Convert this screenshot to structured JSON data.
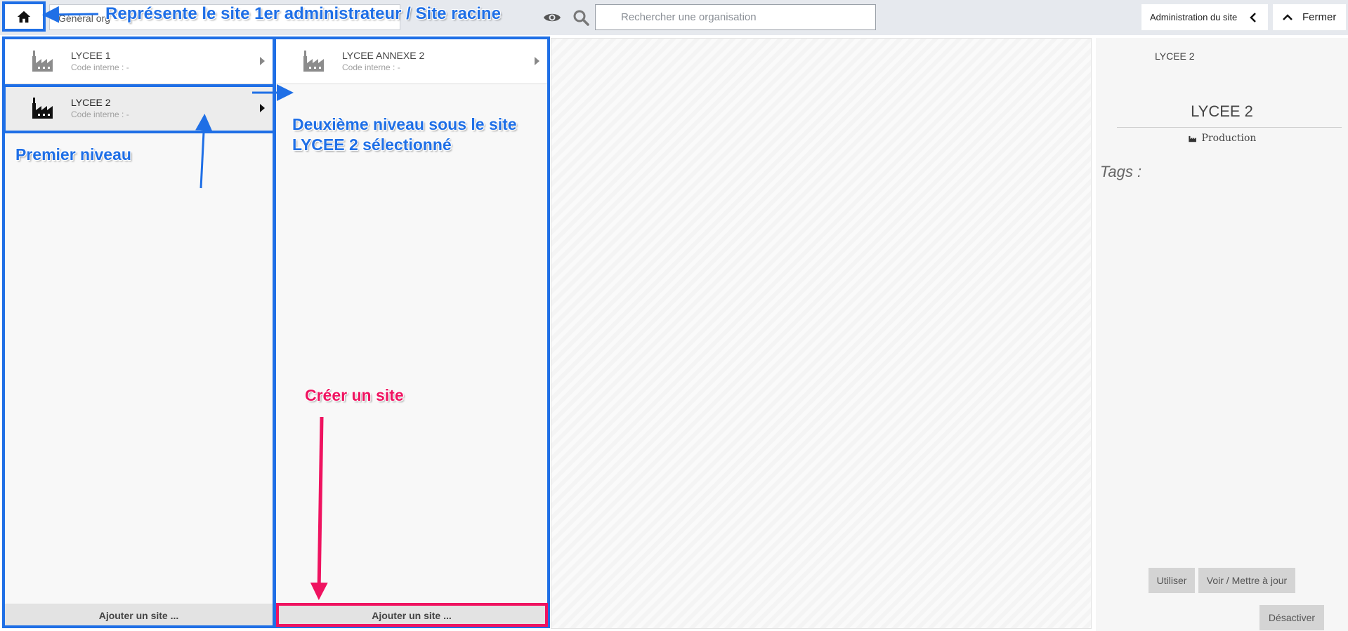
{
  "topbar": {
    "org_select_value": "Général org",
    "search_placeholder": "Rechercher une organisation",
    "admin_label": "Administration du site",
    "close_label": "Fermer"
  },
  "column1": {
    "items": [
      {
        "name": "LYCEE 1",
        "code": "Code interne : -",
        "selected": false
      },
      {
        "name": "LYCEE 2",
        "code": "Code interne : -",
        "selected": true
      }
    ],
    "add_label": "Ajouter un site ..."
  },
  "column2": {
    "items": [
      {
        "name": "LYCEE ANNEXE 2",
        "code": "Code interne : -",
        "selected": false
      }
    ],
    "add_label": "Ajouter un site ..."
  },
  "detail": {
    "breadcrumb": "LYCEE 2",
    "title": "LYCEE 2",
    "type_label": "Production",
    "tags_label": "Tags :",
    "use_label": "Utiliser",
    "update_label": "Voir / Mettre à jour",
    "disable_label": "Désactiver"
  },
  "annotations": {
    "root": "Représente le site 1er administrateur / Site racine",
    "first_level": "Premier niveau",
    "second_level_line1": "Deuxième niveau sous le site",
    "second_level_line2": "LYCEE 2 sélectionné",
    "create_site": "Créer un site"
  },
  "colors": {
    "annotation_blue": "#1f6fe6",
    "annotation_pink": "#ef1360"
  }
}
